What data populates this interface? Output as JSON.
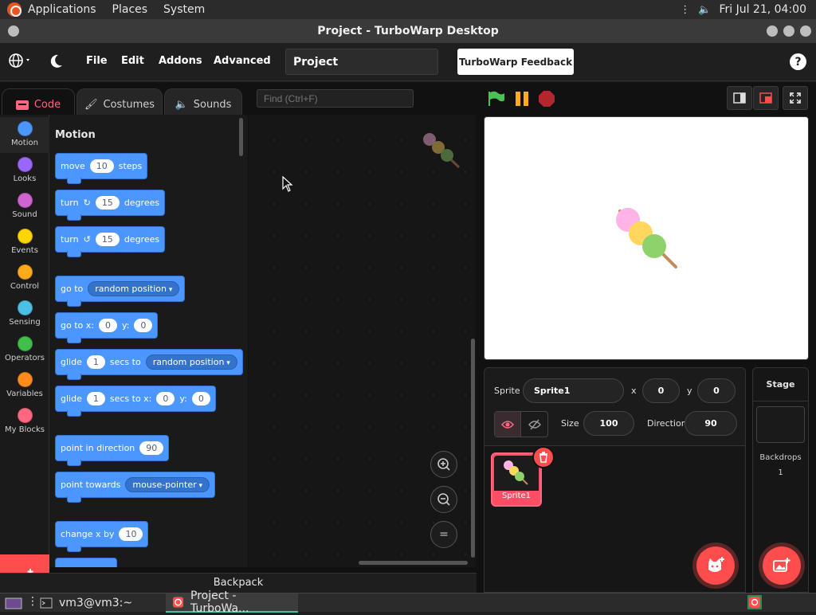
{
  "top_panel": {
    "applications": "Applications",
    "places": "Places",
    "system": "System",
    "clock": "Fri Jul 21, 04:00"
  },
  "window": {
    "title": "Project - TurboWarp Desktop"
  },
  "menubar": {
    "file": "File",
    "edit": "Edit",
    "addons": "Addons",
    "advanced": "Advanced",
    "project_title": "Project",
    "feedback": "TurboWarp Feedback",
    "help": "?"
  },
  "tabs": {
    "code": "Code",
    "costumes": "Costumes",
    "sounds": "Sounds"
  },
  "find": {
    "placeholder": "Find (Ctrl+F)"
  },
  "categories": [
    {
      "label": "Motion",
      "color": "#4c97ff"
    },
    {
      "label": "Looks",
      "color": "#9966ff"
    },
    {
      "label": "Sound",
      "color": "#cf63cf"
    },
    {
      "label": "Events",
      "color": "#ffd500"
    },
    {
      "label": "Control",
      "color": "#ffab19"
    },
    {
      "label": "Sensing",
      "color": "#4cbfe6"
    },
    {
      "label": "Operators",
      "color": "#40bf4a"
    },
    {
      "label": "Variables",
      "color": "#ff8c1a"
    },
    {
      "label": "My Blocks",
      "color": "#ff6680"
    }
  ],
  "palette": {
    "title": "Motion",
    "move": {
      "pre": "move",
      "val": "10",
      "post": "steps"
    },
    "turn_right": {
      "pre": "turn",
      "val": "15",
      "post": "degrees"
    },
    "turn_left": {
      "pre": "turn",
      "val": "15",
      "post": "degrees"
    },
    "goto": {
      "pre": "go to",
      "menu": "random position"
    },
    "gotoxy": {
      "pre": "go to x:",
      "x": "0",
      "mid": "y:",
      "y": "0"
    },
    "glide_to": {
      "pre": "glide",
      "secs": "1",
      "mid": "secs to",
      "menu": "random position"
    },
    "glide_xy": {
      "pre": "glide",
      "secs": "1",
      "mid": "secs to x:",
      "x": "0",
      "mid2": "y:",
      "y": "0"
    },
    "point_dir": {
      "pre": "point in direction",
      "val": "90"
    },
    "point_towards": {
      "pre": "point towards",
      "menu": "mouse-pointer"
    },
    "change_x": {
      "pre": "change x by",
      "val": "10"
    }
  },
  "workspace": {
    "zoom_reset": "="
  },
  "backpack": {
    "label": "Backpack"
  },
  "sprite_info": {
    "sprite_label": "Sprite",
    "sprite_name": "Sprite1",
    "x_label": "x",
    "x": "0",
    "y_label": "y",
    "y": "0",
    "size_label": "Size",
    "size": "100",
    "direction_label": "Direction",
    "direction": "90"
  },
  "sprites": [
    {
      "name": "Sprite1"
    }
  ],
  "stage_panel": {
    "title": "Stage",
    "backdrops_label": "Backdrops",
    "backdrops_count": "1"
  },
  "taskbar": {
    "terminal": "vm3@vm3:~",
    "turbowarp": "Project - TurboWa..."
  },
  "colors": {
    "accent": "#ff4c4c",
    "motion": "#4c97ff",
    "tab_active": "#ff6680"
  }
}
